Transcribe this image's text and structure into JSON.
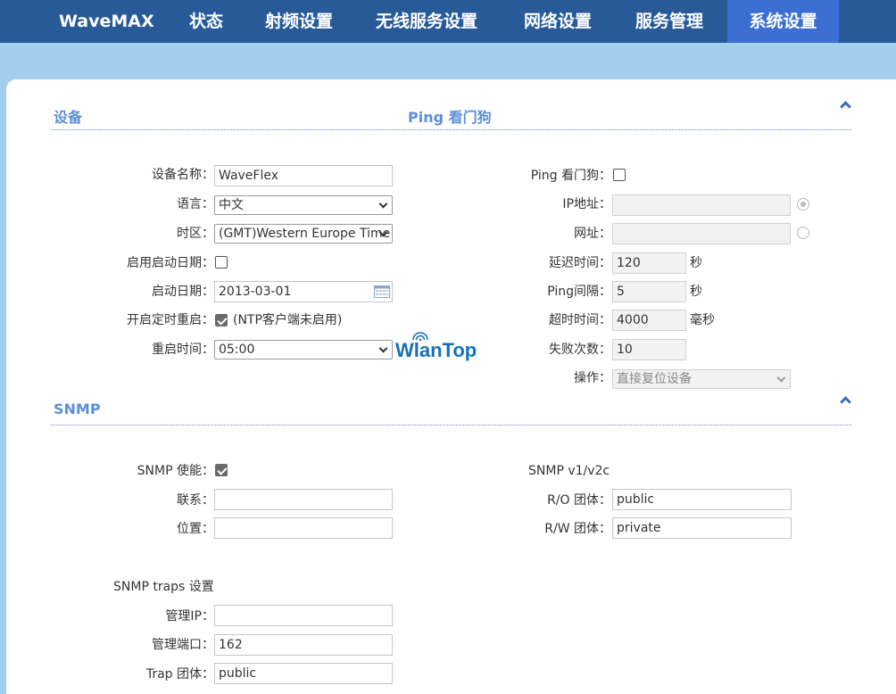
{
  "nav": {
    "brand": "WaveMAX",
    "items": [
      "状态",
      "射频设置",
      "无线服务设置",
      "网络设置",
      "服务管理",
      "系统设置"
    ],
    "active": "系统设置"
  },
  "device": {
    "title": "设备",
    "ping_title": "Ping 看门狗",
    "name_label": "设备名称：",
    "name_value": "WaveFlex",
    "lang_label": "语言：",
    "lang_value": "中文",
    "tz_label": "时区：",
    "tz_value": "(GMT)Western Europe Time",
    "enable_start_label": "启用启动日期：",
    "enable_start_checked": false,
    "start_date_label": "启动日期：",
    "start_date_value": "2013-03-01",
    "timed_reboot_label": "开启定时重启：",
    "timed_reboot_checked": true,
    "timed_reboot_note": "(NTP客户端未启用)",
    "reboot_time_label": "重启时间：",
    "reboot_time_value": "05:00",
    "logo_text": "WlanTop"
  },
  "ping": {
    "enable_label": "Ping 看门狗：",
    "enable_checked": false,
    "ip_label": "IP地址：",
    "ip_value": "",
    "url_label": "网址：",
    "url_value": "",
    "delay_label": "延迟时间：",
    "delay_value": "120",
    "delay_unit": "秒",
    "interval_label": "Ping间隔：",
    "interval_value": "5",
    "interval_unit": "秒",
    "timeout_label": "超时时间：",
    "timeout_value": "4000",
    "timeout_unit": "毫秒",
    "fail_label": "失败次数：",
    "fail_value": "10",
    "action_label": "操作：",
    "action_value": "直接复位设备"
  },
  "snmp": {
    "title": "SNMP",
    "enable_label": "SNMP 使能：",
    "enable_checked": true,
    "contact_label": "联系：",
    "contact_value": "",
    "location_label": "位置：",
    "location_value": "",
    "v1v2c_title": "SNMP v1/v2c",
    "ro_label": "R/O 团体：",
    "ro_value": "public",
    "rw_label": "R/W 团体：",
    "rw_value": "private",
    "traps_title": "SNMP traps 设置",
    "mgmt_ip_label": "管理IP：",
    "mgmt_ip_value": "",
    "mgmt_port_label": "管理端口：",
    "mgmt_port_value": "162",
    "trap_comm_label": "Trap 团体：",
    "trap_comm_value": "public"
  },
  "colors": {
    "nav_bg": "#285a97",
    "nav_active": "#3c6fd2",
    "page_bg": "#a3cfee",
    "section_title": "#5b8fd8",
    "logo": "#1570b8"
  }
}
